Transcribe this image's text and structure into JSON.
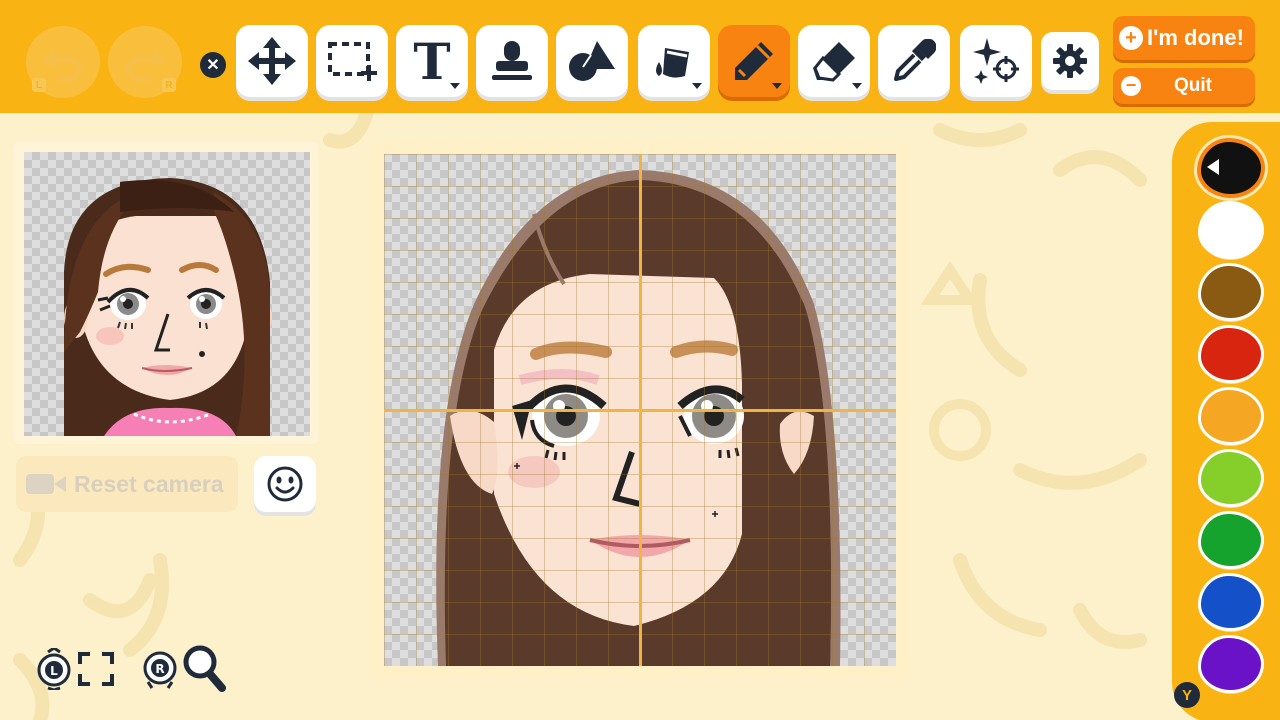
{
  "toolbar": {
    "undo": {
      "icon": "undo-icon",
      "shoulder": "L"
    },
    "redo": {
      "icon": "redo-icon",
      "shoulder": "R"
    },
    "close_badge": "✕",
    "tools": [
      {
        "id": "move",
        "icon": "move-arrows-icon"
      },
      {
        "id": "select",
        "icon": "marquee-select-icon"
      },
      {
        "id": "text",
        "icon": "text-icon",
        "glyph": "T"
      },
      {
        "id": "stamp",
        "icon": "stamp-icon"
      },
      {
        "id": "shapes",
        "icon": "shapes-icon"
      },
      {
        "id": "fill",
        "icon": "paint-bucket-icon"
      },
      {
        "id": "pen",
        "icon": "pen-icon",
        "active": true
      },
      {
        "id": "eraser",
        "icon": "eraser-icon"
      },
      {
        "id": "eyedropper",
        "icon": "eyedropper-icon"
      },
      {
        "id": "effects",
        "icon": "sparkle-icon"
      },
      {
        "id": "settings",
        "icon": "gear-icon"
      }
    ],
    "done_label": "I'm done!",
    "quit_label": "Quit",
    "done_icon": "+",
    "quit_icon": "−"
  },
  "preview": {
    "reset_camera_label": "Reset camera"
  },
  "bottom_controls": {
    "rotate_badge": "L",
    "zoom_badge": "R"
  },
  "palette": {
    "colors": [
      "#111111",
      "#ffffff",
      "#8a5a12",
      "#d8250f",
      "#f5a623",
      "#86cf2a",
      "#15a32d",
      "#1450c8",
      "#6a12c8"
    ],
    "selected_index": 0,
    "badge": "Y"
  }
}
